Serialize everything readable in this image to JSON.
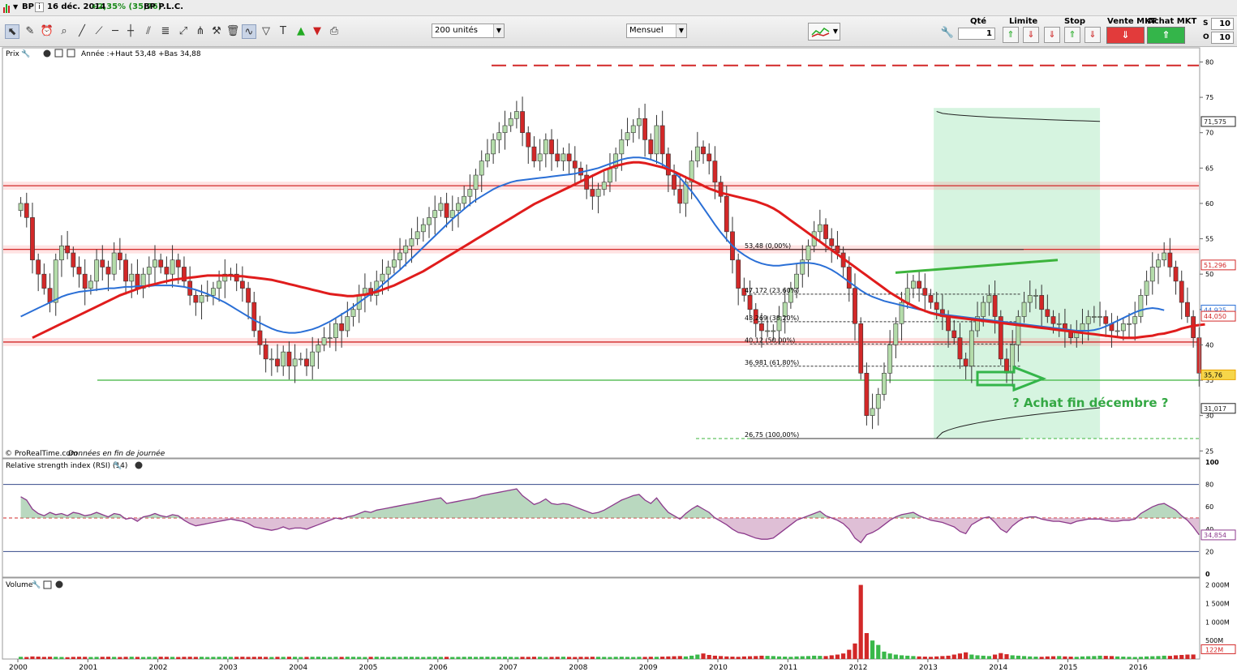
{
  "topbar": {
    "symbol": "BP",
    "info": "i",
    "date": "16 déc. 2014",
    "change": "+2,35% (35,76)",
    "company": "BP P.L.C."
  },
  "toolbar": {
    "units": "200 unités",
    "period": "Mensuel",
    "order": {
      "qty_label": "Qté",
      "limit_label": "Limite",
      "stop_label": "Stop",
      "sell_label": "Vente MKT",
      "buy_label": "Achat MKT",
      "qty_value": "1",
      "side_values": [
        "10",
        "10"
      ],
      "side_labels": [
        "S",
        "O"
      ]
    }
  },
  "colors": {
    "up": "#b4dcaa",
    "down": "#d22828",
    "ma_long": "#e01c1c",
    "ma_short": "#2a6fd6",
    "trend_green": "#3cb43c",
    "zone_fill": "#c8f0d6",
    "rsi_line": "#8c3a8c"
  },
  "price_panel": {
    "title": "Prix",
    "info": "Année :+Haut 53,48 +Bas 34,88",
    "credit": "© ProRealTime.com",
    "credit_note": "Données en fin de journée",
    "annotation": "? Achat fin décembre ?",
    "fib_labels": [
      "53,48 (0,00%)",
      "47,172 (23,60%)",
      "43,269 (38,20%)",
      "40,12 (50,00%)",
      "36,981 (61,80%)",
      "26,75 (100,00%)"
    ],
    "price_tags": [
      "71,575",
      "51,296",
      "44,925",
      "44,050",
      "35,76",
      "31,017"
    ]
  },
  "rsi_panel": {
    "title": "Relative strength index (RSI) (14)",
    "last": "34,854"
  },
  "volume_panel": {
    "title": "Volume",
    "last": "122M"
  },
  "chart_data": [
    {
      "type": "candlestick",
      "frequency": "monthly",
      "y_ticks": [
        25,
        30,
        35,
        40,
        45,
        50,
        55,
        60,
        65,
        70,
        75,
        80
      ],
      "ylim": [
        24,
        82
      ],
      "x_ticks": [
        "2000",
        "2001",
        "2002",
        "2003",
        "2004",
        "2005",
        "2006",
        "2007",
        "2008",
        "2009",
        "2010",
        "2011",
        "2012",
        "2013",
        "2014",
        "2015",
        "2016"
      ],
      "start": "2000-01",
      "close": [
        60,
        58,
        52,
        50,
        48,
        46,
        52,
        54,
        53,
        51,
        50,
        48,
        49,
        52,
        51,
        50,
        53,
        52,
        49,
        50,
        48,
        50,
        51,
        52,
        51,
        50,
        52,
        51,
        49,
        47,
        46,
        47,
        47,
        48,
        49,
        50,
        50,
        49,
        48,
        46,
        42,
        40,
        38,
        38,
        37,
        39,
        37,
        38,
        38,
        37,
        39,
        40,
        41,
        41,
        43,
        42,
        44,
        45,
        47,
        48,
        47,
        49,
        50,
        51,
        52,
        53,
        54,
        55,
        56,
        57,
        58,
        59,
        60,
        58,
        59,
        60,
        61,
        62,
        64,
        66,
        67,
        69,
        70,
        71,
        72,
        73,
        70,
        68,
        66,
        67,
        69,
        67,
        66,
        67,
        66,
        65,
        64,
        62,
        61,
        62,
        63,
        65,
        67,
        69,
        70,
        71,
        72,
        69,
        67,
        71,
        67,
        64,
        62,
        60,
        63,
        66,
        68,
        67,
        66,
        63,
        61,
        56,
        52,
        48,
        47,
        45,
        43,
        42,
        42,
        42,
        44,
        46,
        48,
        50,
        52,
        54,
        56,
        57,
        55,
        54,
        53,
        51,
        48,
        43,
        36,
        30,
        31,
        33,
        36,
        40,
        43,
        46,
        48,
        49,
        48,
        47,
        46,
        45,
        44,
        42,
        41,
        38,
        37,
        42,
        44,
        46,
        47,
        44,
        38,
        36,
        40,
        44,
        46,
        47,
        47,
        45,
        44,
        43,
        43,
        42,
        41,
        42,
        43,
        44,
        44,
        44,
        43,
        42,
        42,
        43,
        43,
        44,
        47,
        49,
        51,
        52,
        53,
        51,
        49,
        46,
        44,
        41,
        36
      ],
      "ma_short": [
        44,
        44.4,
        44.8,
        45.2,
        45.6,
        46,
        46.4,
        46.8,
        47.1,
        47.3,
        47.5,
        47.6,
        47.7,
        47.8,
        47.9,
        48,
        48,
        48.1,
        48.2,
        48.2,
        48.3,
        48.3,
        48.3,
        48.4,
        48.4,
        48.4,
        48.4,
        48.3,
        48.2,
        48,
        47.8,
        47.5,
        47.2,
        46.8,
        46.4,
        46,
        45.5,
        45,
        44.5,
        44,
        43.5,
        43.1,
        42.7,
        42.3,
        42,
        41.8,
        41.7,
        41.7,
        41.8,
        42,
        42.2,
        42.5,
        42.9,
        43.3,
        43.8,
        44.3,
        44.8,
        45.4,
        46,
        46.6,
        47.2,
        47.8,
        48.5,
        49.2,
        49.9,
        50.6,
        51.4,
        52.2,
        53,
        53.8,
        54.6,
        55.4,
        56.2,
        57,
        57.8,
        58.5,
        59.2,
        59.9,
        60.5,
        61,
        61.5,
        62,
        62.4,
        62.7,
        63,
        63.2,
        63.3,
        63.4,
        63.5,
        63.6,
        63.7,
        63.8,
        63.9,
        64,
        64.1,
        64.2,
        64.4,
        64.6,
        64.8,
        65,
        65.3,
        65.6,
        65.9,
        66.2,
        66.4,
        66.5,
        66.5,
        66.4,
        66.2,
        65.9,
        65.5,
        65,
        64.4,
        63.6,
        62.7,
        61.7,
        60.6,
        59.4,
        58.2,
        57,
        55.9,
        54.9,
        54,
        53.3,
        52.7,
        52.2,
        51.8,
        51.5,
        51.3,
        51.2,
        51.2,
        51.3,
        51.4,
        51.5,
        51.6,
        51.6,
        51.5,
        51.3,
        51,
        50.6,
        50.1,
        49.5,
        48.9,
        48.3,
        47.7,
        47.2,
        46.8,
        46.5,
        46.2,
        46,
        45.8,
        45.6,
        45.4,
        45.2,
        45,
        44.8,
        44.6,
        44.4,
        44.3,
        44.2,
        44.1,
        44,
        43.9,
        43.8,
        43.7,
        43.6,
        43.5,
        43.4,
        43.3,
        43.2,
        43.1,
        43,
        42.9,
        42.8,
        42.7,
        42.6,
        42.5,
        42.4,
        42.3,
        42.2,
        42.1,
        42,
        42,
        42,
        42.1,
        42.3,
        42.6,
        43,
        43.4,
        43.8,
        44.2,
        44.6,
        44.9,
        45.1,
        45.2,
        45.1,
        44.9
      ],
      "ma_long": [
        41,
        41.4,
        41.8,
        42.2,
        42.6,
        43,
        43.4,
        43.8,
        44.2,
        44.6,
        45,
        45.4,
        45.8,
        46.2,
        46.6,
        47,
        47.3,
        47.6,
        47.9,
        48.2,
        48.4,
        48.6,
        48.8,
        49,
        49.2,
        49.3,
        49.4,
        49.5,
        49.6,
        49.7,
        49.8,
        49.8,
        49.8,
        49.8,
        49.8,
        49.7,
        49.7,
        49.6,
        49.5,
        49.4,
        49.3,
        49.2,
        49,
        48.8,
        48.6,
        48.4,
        48.2,
        48,
        47.8,
        47.6,
        47.4,
        47.2,
        47.1,
        47,
        46.9,
        46.9,
        47,
        47.1,
        47.3,
        47.5,
        47.8,
        48.1,
        48.4,
        48.8,
        49.2,
        49.6,
        50,
        50.4,
        50.9,
        51.4,
        51.9,
        52.4,
        52.9,
        53.4,
        53.9,
        54.4,
        54.9,
        55.4,
        55.9,
        56.4,
        56.9,
        57.4,
        57.9,
        58.4,
        58.9,
        59.4,
        59.9,
        60.3,
        60.7,
        61.1,
        61.5,
        61.9,
        62.3,
        62.7,
        63.1,
        63.5,
        63.9,
        64.3,
        64.7,
        65,
        65.3,
        65.5,
        65.7,
        65.8,
        65.8,
        65.7,
        65.5,
        65.3,
        65.1,
        64.8,
        64.5,
        64.1,
        63.7,
        63.3,
        62.9,
        62.5,
        62.1,
        61.8,
        61.5,
        61.3,
        61.1,
        60.9,
        60.7,
        60.5,
        60.3,
        60,
        59.7,
        59.3,
        58.8,
        58.2,
        57.6,
        57,
        56.4,
        55.8,
        55.2,
        54.6,
        54,
        53.4,
        52.8,
        52.2,
        51.6,
        51,
        50.4,
        49.8,
        49.2,
        48.6,
        48,
        47.4,
        46.9,
        46.4,
        45.9,
        45.5,
        45.1,
        44.8,
        44.5,
        44.3,
        44.1,
        44,
        43.9,
        43.8,
        43.7,
        43.6,
        43.5,
        43.4,
        43.3,
        43.2,
        43.1,
        43,
        42.9,
        42.8,
        42.7,
        42.6,
        42.5,
        42.4,
        42.3,
        42.2,
        42.1,
        42,
        41.9,
        41.8,
        41.7,
        41.6,
        41.5,
        41.4,
        41.3,
        41.2,
        41.1,
        41,
        41,
        41,
        41.1,
        41.2,
        41.3,
        41.5,
        41.6,
        41.8,
        42,
        42.3,
        42.5,
        42.7,
        42.8,
        42.9
      ],
      "horizontal_levels": {
        "red_dashed": 79.5,
        "red_bands": [
          62.5,
          53.5,
          40.4
        ],
        "green_support": 35
      }
    },
    {
      "type": "line",
      "name": "RSI (14)",
      "ylim": [
        0,
        100
      ],
      "y_ticks": [
        0,
        20,
        40,
        60,
        80,
        100
      ],
      "reference_lines": [
        20,
        50,
        80
      ],
      "values": [
        69,
        66,
        58,
        54,
        52,
        55,
        53,
        54,
        52,
        55,
        54,
        52,
        53,
        55,
        53,
        51,
        54,
        53,
        49,
        50,
        47,
        51,
        52,
        54,
        52,
        51,
        53,
        52,
        48,
        45,
        43,
        44,
        45,
        46,
        47,
        48,
        49,
        48,
        47,
        45,
        42,
        41,
        40,
        39,
        40,
        42,
        40,
        41,
        41,
        40,
        42,
        44,
        46,
        48,
        50,
        49,
        51,
        52,
        54,
        56,
        55,
        57,
        58,
        59,
        60,
        61,
        62,
        63,
        64,
        65,
        66,
        67,
        68,
        63,
        64,
        65,
        66,
        67,
        68,
        70,
        71,
        72,
        73,
        74,
        75,
        76,
        70,
        66,
        62,
        64,
        67,
        63,
        62,
        63,
        62,
        60,
        58,
        56,
        54,
        55,
        57,
        60,
        63,
        66,
        68,
        70,
        71,
        66,
        63,
        68,
        61,
        55,
        52,
        49,
        54,
        58,
        61,
        58,
        55,
        50,
        47,
        44,
        40,
        37,
        36,
        34,
        32,
        31,
        31,
        32,
        36,
        40,
        44,
        48,
        50,
        52,
        54,
        56,
        52,
        50,
        48,
        45,
        40,
        32,
        28,
        35,
        37,
        40,
        44,
        48,
        51,
        53,
        54,
        55,
        52,
        50,
        48,
        47,
        46,
        44,
        42,
        38,
        36,
        44,
        47,
        50,
        51,
        46,
        40,
        37,
        43,
        47,
        50,
        51,
        51,
        49,
        48,
        47,
        47,
        46,
        45,
        47,
        48,
        49,
        49,
        49,
        48,
        47,
        47,
        48,
        48,
        49,
        54,
        57,
        60,
        62,
        63,
        60,
        57,
        52,
        48,
        42,
        35
      ]
    },
    {
      "type": "bar",
      "name": "Volume",
      "y_ticks": [
        "500M",
        "1 000M",
        "1 500M",
        "2 000M"
      ],
      "ylim": [
        0,
        2100
      ],
      "values": [
        60,
        55,
        70,
        65,
        58,
        62,
        60,
        55,
        50,
        58,
        62,
        60,
        55,
        58,
        60,
        62,
        58,
        55,
        60,
        62,
        58,
        55,
        60,
        58,
        62,
        60,
        58,
        55,
        60,
        62,
        58,
        60,
        55,
        58,
        60,
        62,
        58,
        60,
        62,
        58,
        60,
        62,
        58,
        55,
        60,
        58,
        62,
        60,
        55,
        58,
        60,
        62,
        58,
        55,
        60,
        58,
        62,
        60,
        58,
        55,
        60,
        62,
        58,
        55,
        60,
        58,
        62,
        60,
        58,
        55,
        60,
        62,
        58,
        60,
        55,
        58,
        60,
        62,
        58,
        60,
        62,
        58,
        60,
        62,
        58,
        55,
        60,
        58,
        62,
        60,
        55,
        58,
        60,
        62,
        58,
        55,
        60,
        58,
        62,
        60,
        58,
        55,
        60,
        62,
        58,
        55,
        60,
        58,
        62,
        60,
        65,
        70,
        75,
        80,
        70,
        90,
        120,
        150,
        110,
        90,
        80,
        70,
        65,
        60,
        70,
        75,
        80,
        90,
        85,
        80,
        70,
        65,
        60,
        70,
        75,
        80,
        90,
        85,
        80,
        100,
        120,
        150,
        250,
        420,
        2000,
        700,
        500,
        380,
        200,
        150,
        120,
        100,
        90,
        80,
        70,
        65,
        60,
        70,
        80,
        90,
        120,
        150,
        180,
        120,
        100,
        90,
        80,
        120,
        160,
        130,
        100,
        90,
        80,
        70,
        65,
        60,
        70,
        75,
        80,
        70,
        65,
        60,
        70,
        75,
        80,
        90,
        85,
        80,
        70,
        65,
        60,
        55,
        60,
        70,
        75,
        80,
        90,
        85,
        100,
        110,
        120,
        122
      ]
    }
  ]
}
